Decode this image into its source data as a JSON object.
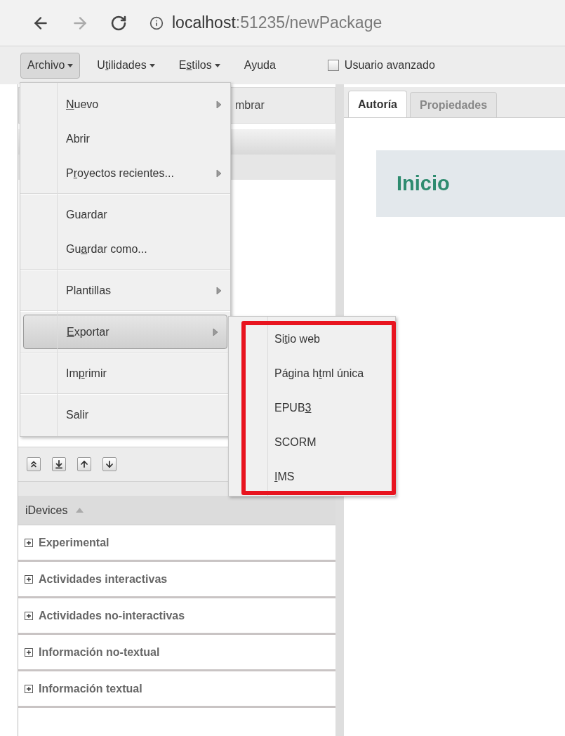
{
  "browser": {
    "url_host": "localhost",
    "url_rest": ":51235/newPackage"
  },
  "menubar": {
    "items": [
      {
        "pre": "Archivo",
        "caret": true,
        "selected": true
      },
      {
        "pre": "U",
        "key": "t",
        "post": "ilidades",
        "caret": true,
        "selected": false
      },
      {
        "pre": "E",
        "key": "s",
        "post": "tilos",
        "caret": true,
        "selected": false
      },
      {
        "pre": "Ayuda",
        "caret": false,
        "selected": false
      }
    ],
    "checkbox": {
      "label": "Usuario avanzado",
      "checked": false
    }
  },
  "outline_panel": {
    "toolbar_text": "mbrar"
  },
  "idevices": {
    "title": "iDevices",
    "expanded": true,
    "categories": [
      {
        "label": "Experimental",
        "expanded": false
      },
      {
        "label": "Actividades interactivas",
        "expanded": false
      },
      {
        "label": "Actividades no-interactivas",
        "expanded": false
      },
      {
        "label": "Información no-textual",
        "expanded": false
      },
      {
        "label": "Información textual",
        "expanded": false
      }
    ]
  },
  "tabs": [
    {
      "label": "Autoría",
      "selected": true
    },
    {
      "label": "Propiedades",
      "selected": false
    }
  ],
  "page_title": "Inicio",
  "file_menu": [
    {
      "kind": "item",
      "key": "N",
      "post": "uevo",
      "submenu": true,
      "selected": false
    },
    {
      "kind": "item",
      "pre": "Abrir",
      "submenu": false,
      "selected": false
    },
    {
      "kind": "item",
      "pre": "P",
      "key": "r",
      "post": "oyectos recientes...",
      "submenu": true,
      "selected": false
    },
    {
      "kind": "separator"
    },
    {
      "kind": "item",
      "pre": "Guardar",
      "submenu": false,
      "selected": false
    },
    {
      "kind": "item",
      "pre": "Gu",
      "key": "a",
      "post": "rdar como...",
      "submenu": false,
      "selected": false
    },
    {
      "kind": "separator"
    },
    {
      "kind": "item",
      "pre": "Plantillas",
      "submenu": true,
      "selected": false
    },
    {
      "kind": "separator"
    },
    {
      "kind": "item",
      "key": "E",
      "post": "xportar",
      "submenu": true,
      "selected": true
    },
    {
      "kind": "separator"
    },
    {
      "kind": "item",
      "pre": "Im",
      "key": "p",
      "post": "rimir",
      "submenu": false,
      "selected": false
    },
    {
      "kind": "separator"
    },
    {
      "kind": "item",
      "pre": "Salir",
      "submenu": false,
      "selected": false
    }
  ],
  "export_menu": [
    {
      "pre": "Si",
      "key": "t",
      "post": "io web"
    },
    {
      "pre": "Página h",
      "key": "t",
      "post": "ml única"
    },
    {
      "pre": "EPUB",
      "key": "3"
    },
    {
      "pre": "SCORM"
    },
    {
      "key": "I",
      "post": "MS"
    }
  ]
}
